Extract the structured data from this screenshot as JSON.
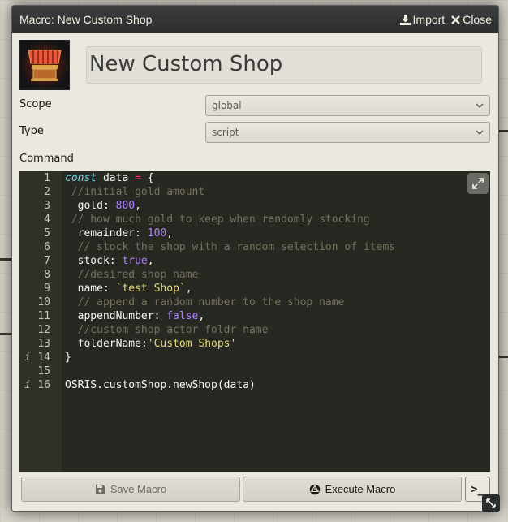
{
  "window": {
    "title": "Macro: New Custom Shop",
    "import_label": "Import",
    "close_label": "Close"
  },
  "macro": {
    "name": "New Custom Shop",
    "scope_label": "Scope",
    "scope_value": "global",
    "type_label": "Type",
    "type_value": "script",
    "command_label": "Command"
  },
  "editor": {
    "lines": [
      {
        "n": "1",
        "info": false
      },
      {
        "n": "2",
        "info": false
      },
      {
        "n": "3",
        "info": false
      },
      {
        "n": "4",
        "info": false
      },
      {
        "n": "5",
        "info": false
      },
      {
        "n": "6",
        "info": false
      },
      {
        "n": "7",
        "info": false
      },
      {
        "n": "8",
        "info": false
      },
      {
        "n": "9",
        "info": false
      },
      {
        "n": "10",
        "info": false
      },
      {
        "n": "11",
        "info": false
      },
      {
        "n": "12",
        "info": false
      },
      {
        "n": "13",
        "info": false
      },
      {
        "n": "14",
        "info": true
      },
      {
        "n": "15",
        "info": false
      },
      {
        "n": "16",
        "info": true
      }
    ],
    "code": {
      "l1_kw": "const",
      "l1_name": " data ",
      "l1_eq": "=",
      "l1_brace": " {",
      "l2": " //initial gold amount",
      "l3_key": "  gold: ",
      "l3_val": "800",
      "l3_end": ",",
      "l4": " // how much gold to keep when randomly stocking",
      "l5_key": "  remainder: ",
      "l5_val": "100",
      "l5_end": ",",
      "l6": "  // stock the shop with a random selection of items",
      "l7_key": "  stock: ",
      "l7_val": "true",
      "l7_end": ",",
      "l8": "  //desired shop name",
      "l9_key": "  name: ",
      "l9_val": "`test Shop`",
      "l9_end": ",",
      "l10": "  // append a random number to the shop name",
      "l11_key": "  appendNumber: ",
      "l11_val": "false",
      "l11_end": ",",
      "l12": "  //custom shop actor foldr name",
      "l13_key": "  folderName:",
      "l13_val": "'Custom Shops'",
      "l14": "}",
      "l15": "",
      "l16": "OSRIS.customShop.newShop(data)"
    },
    "info_marker": "i"
  },
  "footer": {
    "save_label": "Save Macro",
    "execute_label": "Execute Macro",
    "console_label": ">_"
  },
  "colors": {
    "editor_bg": "#272822",
    "keyword": "#66d9ef",
    "operator": "#f92672",
    "number": "#ae81ff",
    "comment": "#75715e",
    "string": "#e6db74"
  }
}
